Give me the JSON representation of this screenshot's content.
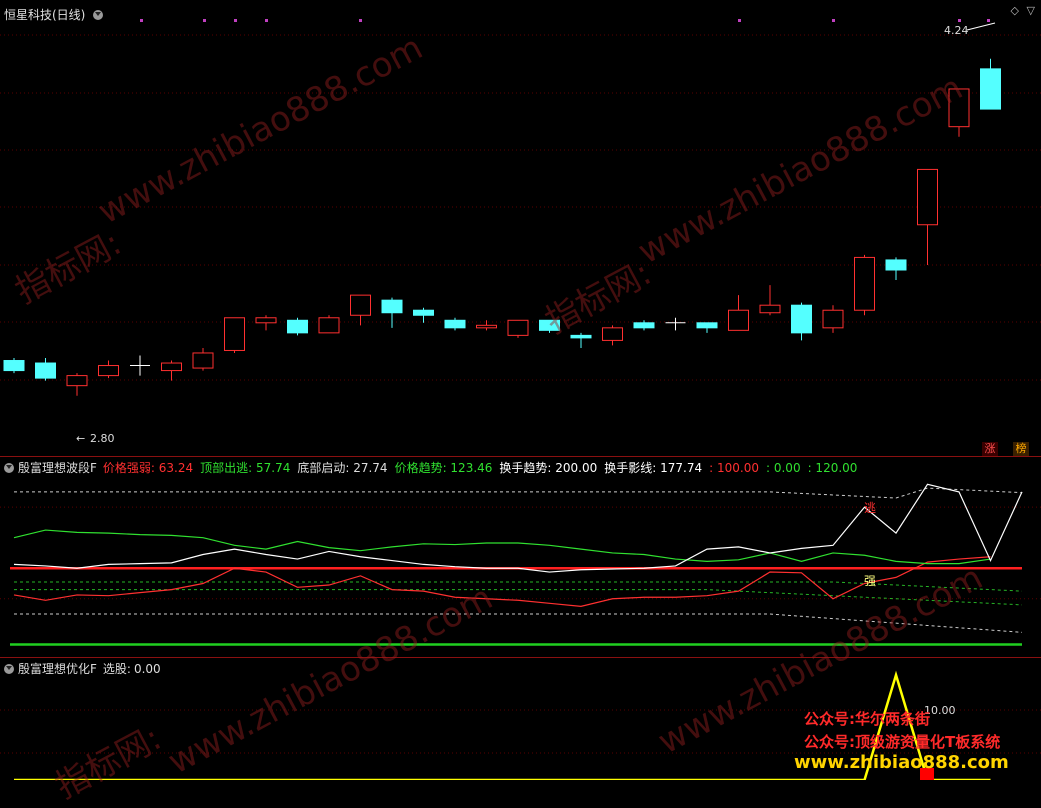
{
  "stock_title": "恒星科技(日线)",
  "price_high_label": "4.24",
  "price_low_label": "2.80",
  "badges": {
    "zhang": "涨",
    "bang": "榜"
  },
  "indicator1": {
    "name": "殷富理想波段F",
    "items": [
      {
        "label": "价格强弱:",
        "value": "63.24",
        "color": "#ff3030"
      },
      {
        "label": "顶部出逃:",
        "value": "57.74",
        "color": "#30e030"
      },
      {
        "label": "底部启动:",
        "value": "27.74",
        "color": "#dddddd"
      },
      {
        "label": "价格趋势:",
        "value": "123.46",
        "color": "#30e030"
      },
      {
        "label": "换手趋势:",
        "value": "200.00",
        "color": "#ffffff"
      },
      {
        "label": "换手影线:",
        "value": "177.74",
        "color": "#ffffff"
      },
      {
        "label": ":",
        "value": "100.00",
        "color": "#ff3030"
      },
      {
        "label": ":",
        "value": "0.00",
        "color": "#30e030"
      },
      {
        "label": ":",
        "value": "120.00",
        "color": "#30e030"
      }
    ],
    "markers": {
      "top": "逃",
      "bottom": "强"
    }
  },
  "indicator2": {
    "name": "殷富理想优化F",
    "item_label": "选股:",
    "item_value": "0.00",
    "peak_label": "10.00"
  },
  "watermark": {
    "site": "www.zhibiao888.com",
    "cn": "指标网:"
  },
  "stamps": {
    "line1": "公众号:华尔两条街",
    "line2": "公众号:顶级游资量化T板系统",
    "site": "www.zhibiao888.com"
  },
  "chart_data": [
    {
      "type": "candlestick",
      "title": "恒星科技(日线)",
      "ylim": [
        2.6,
        4.35
      ],
      "annotations": [
        {
          "label": "4.24",
          "value": 4.24
        },
        {
          "label": "2.80",
          "value": 2.8
        }
      ],
      "candles": [
        {
          "o": 2.94,
          "c": 2.9,
          "h": 2.95,
          "l": 2.89
        },
        {
          "o": 2.93,
          "c": 2.87,
          "h": 2.95,
          "l": 2.86
        },
        {
          "o": 2.84,
          "c": 2.88,
          "h": 2.89,
          "l": 2.8
        },
        {
          "o": 2.88,
          "c": 2.92,
          "h": 2.94,
          "l": 2.87
        },
        {
          "o": 2.92,
          "c": 2.92,
          "h": 2.96,
          "l": 2.88
        },
        {
          "o": 2.9,
          "c": 2.93,
          "h": 2.94,
          "l": 2.86
        },
        {
          "o": 2.91,
          "c": 2.97,
          "h": 2.99,
          "l": 2.9
        },
        {
          "o": 2.98,
          "c": 3.11,
          "h": 3.11,
          "l": 2.97
        },
        {
          "o": 3.09,
          "c": 3.11,
          "h": 3.12,
          "l": 3.06
        },
        {
          "o": 3.1,
          "c": 3.05,
          "h": 3.11,
          "l": 3.04
        },
        {
          "o": 3.05,
          "c": 3.11,
          "h": 3.12,
          "l": 3.05
        },
        {
          "o": 3.12,
          "c": 3.2,
          "h": 3.2,
          "l": 3.08
        },
        {
          "o": 3.18,
          "c": 3.13,
          "h": 3.19,
          "l": 3.07
        },
        {
          "o": 3.14,
          "c": 3.12,
          "h": 3.15,
          "l": 3.09
        },
        {
          "o": 3.1,
          "c": 3.07,
          "h": 3.11,
          "l": 3.06
        },
        {
          "o": 3.07,
          "c": 3.08,
          "h": 3.1,
          "l": 3.06
        },
        {
          "o": 3.04,
          "c": 3.1,
          "h": 3.1,
          "l": 3.03
        },
        {
          "o": 3.1,
          "c": 3.06,
          "h": 3.1,
          "l": 3.05
        },
        {
          "o": 3.04,
          "c": 3.03,
          "h": 3.05,
          "l": 2.99
        },
        {
          "o": 3.02,
          "c": 3.07,
          "h": 3.08,
          "l": 3.0
        },
        {
          "o": 3.09,
          "c": 3.07,
          "h": 3.1,
          "l": 3.06
        },
        {
          "o": 3.09,
          "c": 3.09,
          "h": 3.11,
          "l": 3.06
        },
        {
          "o": 3.09,
          "c": 3.07,
          "h": 3.09,
          "l": 3.05
        },
        {
          "o": 3.06,
          "c": 3.14,
          "h": 3.2,
          "l": 3.06
        },
        {
          "o": 3.13,
          "c": 3.16,
          "h": 3.24,
          "l": 3.12
        },
        {
          "o": 3.16,
          "c": 3.05,
          "h": 3.17,
          "l": 3.02
        },
        {
          "o": 3.07,
          "c": 3.14,
          "h": 3.16,
          "l": 3.05
        },
        {
          "o": 3.14,
          "c": 3.35,
          "h": 3.36,
          "l": 3.12
        },
        {
          "o": 3.34,
          "c": 3.3,
          "h": 3.35,
          "l": 3.26
        },
        {
          "o": 3.48,
          "c": 3.7,
          "h": 3.7,
          "l": 3.32
        },
        {
          "o": 3.87,
          "c": 4.02,
          "h": 4.02,
          "l": 3.83
        },
        {
          "o": 4.1,
          "c": 3.94,
          "h": 4.14,
          "l": 3.94
        }
      ]
    },
    {
      "type": "line",
      "title": "殷富理想波段F",
      "ylim": [
        -15,
        230
      ],
      "reference_lines": [
        {
          "value": 100,
          "color": "#ff2020"
        },
        {
          "value": 0,
          "color": "#20d020"
        }
      ],
      "series": [
        {
          "name": "价格强弱",
          "color": "#ff3030",
          "values": [
            65,
            58,
            65,
            64,
            68,
            72,
            80,
            100,
            95,
            75,
            78,
            90,
            72,
            70,
            62,
            60,
            58,
            54,
            50,
            60,
            62,
            62,
            64,
            70,
            95,
            94,
            60,
            80,
            88,
            108,
            112,
            115
          ]
        },
        {
          "name": "价格趋势",
          "color": "#30e030",
          "values": [
            140,
            150,
            147,
            146,
            144,
            143,
            140,
            130,
            125,
            135,
            127,
            123,
            128,
            132,
            131,
            133,
            133,
            130,
            125,
            120,
            118,
            112,
            109,
            111,
            120,
            109,
            120,
            117,
            109,
            106,
            106,
            112
          ]
        },
        {
          "name": "换手影线",
          "color": "#ffffff",
          "values": [
            105,
            103,
            100,
            105,
            106,
            107,
            118,
            125,
            118,
            112,
            122,
            115,
            110,
            105,
            102,
            100,
            100,
            95,
            98,
            99,
            100,
            103,
            125,
            128,
            120,
            126,
            130,
            180,
            146,
            210,
            200,
            110,
            200
          ]
        }
      ]
    },
    {
      "type": "line",
      "title": "殷富理想优化F",
      "series": [
        {
          "name": "选股",
          "color": "#ffff00",
          "values": [
            0,
            0,
            0,
            0,
            0,
            0,
            0,
            0,
            0,
            0,
            0,
            0,
            0,
            0,
            0,
            0,
            0,
            0,
            0,
            0,
            0,
            0,
            0,
            0,
            0,
            0,
            0,
            0,
            10,
            0,
            0,
            0
          ]
        }
      ]
    }
  ]
}
